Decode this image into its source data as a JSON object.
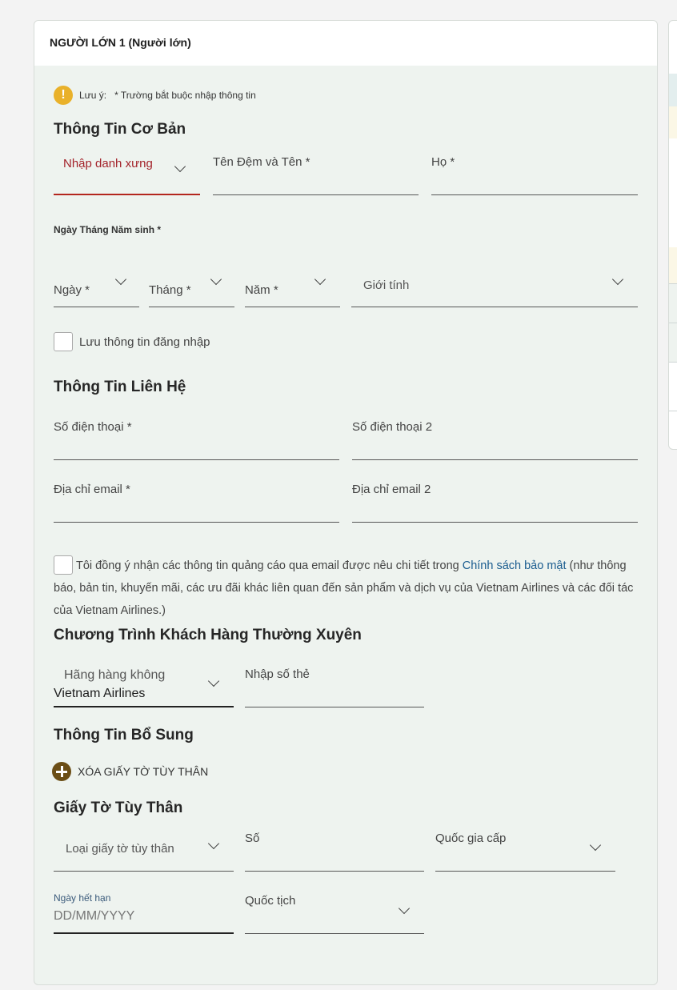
{
  "passenger": {
    "title": "NGƯỜI LỚN 1 (Người lớn)"
  },
  "note": {
    "icon": "exclamation-icon",
    "label": "Lưu ý:",
    "text": "* Trường bắt buộc nhập thông tin"
  },
  "basic_info": {
    "title": "Thông Tin Cơ Bản",
    "salutation_placeholder": "Nhập danh xưng",
    "first_middle_name_label": "Tên Đệm và Tên *",
    "last_name_label": "Họ *",
    "dob_label": "Ngày Tháng Năm sinh *",
    "day_label": "Ngày *",
    "month_label": "Tháng *",
    "year_label": "Năm *",
    "gender_label": "Giới tính",
    "save_login_label": "Lưu thông tin đăng nhập"
  },
  "contact_info": {
    "title": "Thông Tin Liên Hệ",
    "phone_label": "Số điện thoại *",
    "phone2_label": "Số điện thoại 2",
    "email_label": "Địa chỉ email *",
    "email2_label": "Địa chỉ email 2",
    "consent_before": "Tôi đồng ý nhận các thông tin quảng cáo qua email được nêu chi tiết trong",
    "consent_link": "Chính sách bảo mật",
    "consent_after": "(như thông báo, bản tin, khuyến mãi, các ưu đãi khác liên quan đến sản phẩm và dịch vụ của Vietnam Airlines và các đối tác của Vietnam Airlines.)"
  },
  "frequent_flyer": {
    "title": "Chương Trình Khách Hàng Thường Xuyên",
    "airline_label": "Hãng hàng không",
    "airline_value": "Vietnam Airlines",
    "card_number_label": "Nhập số thẻ"
  },
  "additional_info": {
    "title": "Thông Tin Bổ Sung",
    "remove_id_label": "XÓA GIẤY TỜ TÙY THÂN"
  },
  "id_document": {
    "title": "Giấy Tờ Tùy Thân",
    "doc_type_label": "Loại giấy tờ tùy thân",
    "number_label": "Số",
    "issuing_country_label": "Quốc gia cấp",
    "expiry_label": "Ngày hết hạn",
    "expiry_placeholder": "DD/MM/YYYY",
    "nationality_label": "Quốc tịch"
  },
  "colors": {
    "accent_red": "#b3261e",
    "gold": "#e9b12a",
    "brown": "#6b4e16",
    "link_blue": "#1a5c8f",
    "panel_bg": "#eef3ef"
  }
}
